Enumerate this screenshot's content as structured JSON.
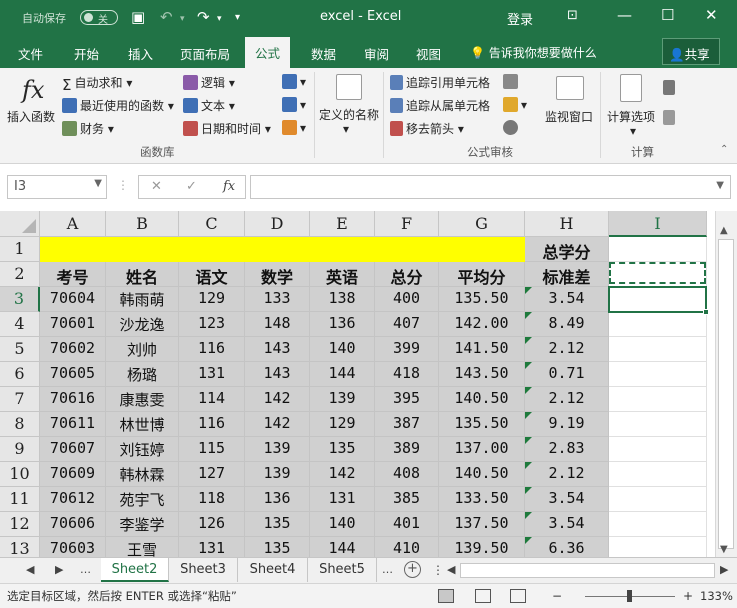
{
  "titlebar": {
    "autosave_label": "自动保存",
    "autosave_state": "关",
    "doc_title": "excel  -  Excel",
    "login": "登录"
  },
  "tabs": [
    "文件",
    "开始",
    "插入",
    "页面布局",
    "公式",
    "数据",
    "审阅",
    "视图"
  ],
  "active_tab": "公式",
  "tellme": "告诉我你想要做什么",
  "share": "共享",
  "ribbon": {
    "insert_function": "插入函数",
    "autosum": "自动求和",
    "recent": "最近使用的函数",
    "financial": "财务",
    "logical": "逻辑",
    "text": "文本",
    "datetime": "日期和时间",
    "function_library": "函数库",
    "defined_names": "定义的名称",
    "trace_precedents": "追踪引用单元格",
    "trace_dependents": "追踪从属单元格",
    "remove_arrows": "移去箭头",
    "watch_window": "监视窗口",
    "formula_auditing": "公式审核",
    "calc_options": "计算选项",
    "calculation": "计算"
  },
  "formula_bar": {
    "name_box": "I3",
    "fx": "fx",
    "value": ""
  },
  "columns": [
    "A",
    "B",
    "C",
    "D",
    "E",
    "F",
    "G",
    "H",
    "I"
  ],
  "rows": [
    "1",
    "2",
    "3",
    "4",
    "5",
    "6",
    "7",
    "8",
    "9",
    "10",
    "11",
    "12",
    "13"
  ],
  "table": {
    "h_top": "总学分",
    "headers": [
      "考号",
      "姓名",
      "语文",
      "数学",
      "英语",
      "总分",
      "平均分",
      "标准差"
    ],
    "data": [
      [
        "70604",
        "韩雨萌",
        "129",
        "133",
        "138",
        "400",
        "135.50",
        "3.54"
      ],
      [
        "70601",
        "沙龙逸",
        "123",
        "148",
        "136",
        "407",
        "142.00",
        "8.49"
      ],
      [
        "70602",
        "刘帅",
        "116",
        "143",
        "140",
        "399",
        "141.50",
        "2.12"
      ],
      [
        "70605",
        "杨璐",
        "131",
        "143",
        "144",
        "418",
        "143.50",
        "0.71"
      ],
      [
        "70616",
        "康惠雯",
        "114",
        "142",
        "139",
        "395",
        "140.50",
        "2.12"
      ],
      [
        "70611",
        "林世博",
        "116",
        "142",
        "129",
        "387",
        "135.50",
        "9.19"
      ],
      [
        "70607",
        "刘钰婷",
        "115",
        "139",
        "135",
        "389",
        "137.00",
        "2.83"
      ],
      [
        "70609",
        "韩林霖",
        "127",
        "139",
        "142",
        "408",
        "140.50",
        "2.12"
      ],
      [
        "70612",
        "苑宇飞",
        "118",
        "136",
        "131",
        "385",
        "133.50",
        "3.54"
      ],
      [
        "70606",
        "李鉴学",
        "126",
        "135",
        "140",
        "401",
        "137.50",
        "3.54"
      ],
      [
        "70603",
        "王雪",
        "131",
        "135",
        "144",
        "410",
        "139.50",
        "6.36"
      ]
    ]
  },
  "sheets": [
    "Sheet2",
    "Sheet3",
    "Sheet4",
    "Sheet5"
  ],
  "active_sheet": "Sheet2",
  "status": {
    "message": "选定目标区域，然后按 ENTER 或选择“粘贴”",
    "zoom": "133%"
  },
  "colors": {
    "excel_green": "#217346",
    "highlight_yellow": "#ffff00"
  }
}
